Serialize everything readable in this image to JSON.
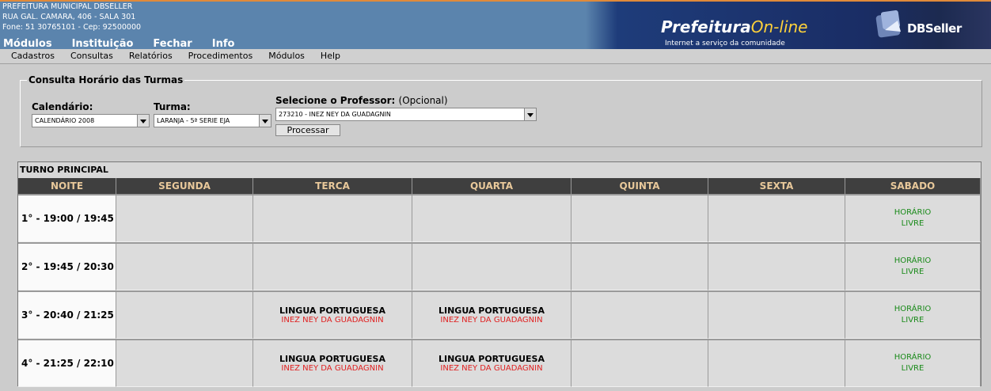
{
  "header": {
    "org_name": "PREFEITURA MUNICIPAL DBSELLER",
    "address": "RUA GAL. CAMARA, 406 - SALA 301",
    "contact": "Fone: 51 30765101  -  Cep: 92500000",
    "top_menu": [
      "Módulos",
      "Instituição",
      "Fechar",
      "Info"
    ],
    "banner_title_a": "Prefeitura",
    "banner_title_b": "On-line",
    "banner_subtitle": "Internet a serviço da comunidade",
    "vendor": "DBSeller"
  },
  "menubar": [
    "Cadastros",
    "Consultas",
    "Relatórios",
    "Procedimentos",
    "Módulos",
    "Help"
  ],
  "filter": {
    "legend": "Consulta Horário das Turmas",
    "calendario_label": "Calendário:",
    "calendario_value": "CALENDÁRIO 2008",
    "turma_label": "Turma:",
    "turma_value": "LARANJA - 5ª SERIE EJA",
    "professor_label": "Selecione o Professor:",
    "professor_optional": "(Opcional)",
    "professor_value": "273210 - INEZ NEY DA GUADAGNIN",
    "submit_label": "Processar"
  },
  "schedule": {
    "turno": "TURNO PRINCIPAL",
    "columns": [
      "NOITE",
      "SEGUNDA",
      "TERCA",
      "QUARTA",
      "QUINTA",
      "SEXTA",
      "SABADO"
    ],
    "rows": [
      {
        "time": "1° - 19:00 / 19:45",
        "cells": [
          null,
          null,
          null,
          null,
          null,
          {
            "livre": [
              "HORÁRIO",
              "LIVRE"
            ]
          }
        ]
      },
      {
        "time": "2° - 19:45 / 20:30",
        "cells": [
          null,
          null,
          null,
          null,
          null,
          {
            "livre": [
              "HORÁRIO",
              "LIVRE"
            ]
          }
        ]
      },
      {
        "time": "3° - 20:40 / 21:25",
        "cells": [
          null,
          {
            "subject": "LINGUA PORTUGUESA",
            "teacher": "INEZ NEY DA GUADAGNIN"
          },
          {
            "subject": "LINGUA PORTUGUESA",
            "teacher": "INEZ NEY DA GUADAGNIN"
          },
          null,
          null,
          {
            "livre": [
              "HORÁRIO",
              "LIVRE"
            ]
          }
        ]
      },
      {
        "time": "4° - 21:25 / 22:10",
        "cells": [
          null,
          {
            "subject": "LINGUA PORTUGUESA",
            "teacher": "INEZ NEY DA GUADAGNIN"
          },
          {
            "subject": "LINGUA PORTUGUESA",
            "teacher": "INEZ NEY DA GUADAGNIN"
          },
          null,
          null,
          {
            "livre": [
              "HORÁRIO",
              "LIVRE"
            ]
          }
        ]
      }
    ]
  }
}
